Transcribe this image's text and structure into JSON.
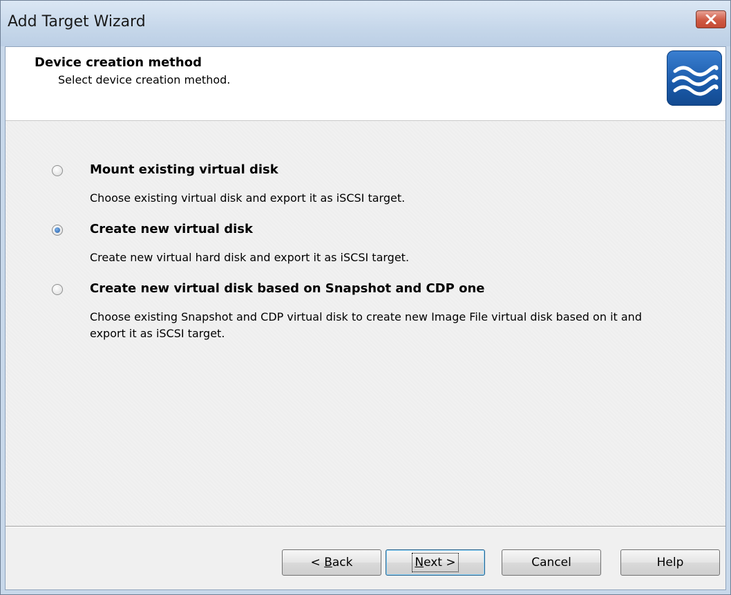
{
  "window": {
    "title": "Add Target Wizard"
  },
  "header": {
    "title": "Device creation method",
    "subtitle": "Select device creation method."
  },
  "options": [
    {
      "label": "Mount existing virtual disk",
      "description": "Choose existing virtual disk and export it as iSCSI target.",
      "selected": false
    },
    {
      "label": "Create new virtual disk",
      "description": "Create new virtual hard disk and export it as iSCSI target.",
      "selected": true
    },
    {
      "label": "Create new virtual disk based on Snapshot and CDP one",
      "description": "Choose existing Snapshot and CDP virtual disk to create new Image File virtual disk based on it and export it as iSCSI target.",
      "selected": false
    }
  ],
  "buttons": {
    "back": {
      "prefix": "< ",
      "mnemonic": "B",
      "rest": "ack"
    },
    "next": {
      "mnemonic": "N",
      "rest": "ext >"
    },
    "cancel": "Cancel",
    "help": "Help"
  },
  "icons": {
    "close": "close-icon",
    "logo": "wave-logo-icon"
  },
  "colors": {
    "logo_blue": "#1a5aa9",
    "close_red": "#cf5a44",
    "radio_checked": "#1e5aa8"
  }
}
